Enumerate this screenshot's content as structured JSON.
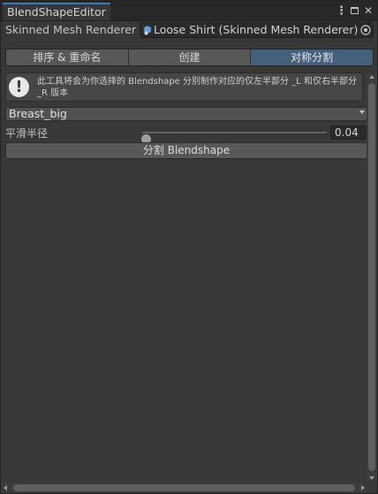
{
  "window": {
    "tab_title": "BlendShapeEditor",
    "icons": [
      "kebab-menu-icon",
      "maximize-icon",
      "close-icon"
    ]
  },
  "mesh_field": {
    "label": "Skinned Mesh Renderer",
    "value": "Loose Shirt (Skinned Mesh Renderer)",
    "icon": "skinned-mesh-icon"
  },
  "toolbar": {
    "tabs": [
      {
        "label": "排序 & 重命名",
        "active": false
      },
      {
        "label": "创建",
        "active": false
      },
      {
        "label": "对称分割",
        "active": true
      }
    ],
    "active_color": "#46607c"
  },
  "help": {
    "icon": "info-exclamation-icon",
    "text": "此工具将会为你选择的 Blendshape 分别制作对应的仅左半部分 _L 和仅右半部分 _R 版本"
  },
  "blendshape_select": {
    "value": "Breast_big"
  },
  "smooth_radius": {
    "label": "平滑半径",
    "value": "0.04",
    "fraction": 0.02
  },
  "split_button": {
    "label": "分割 Blendshape"
  }
}
